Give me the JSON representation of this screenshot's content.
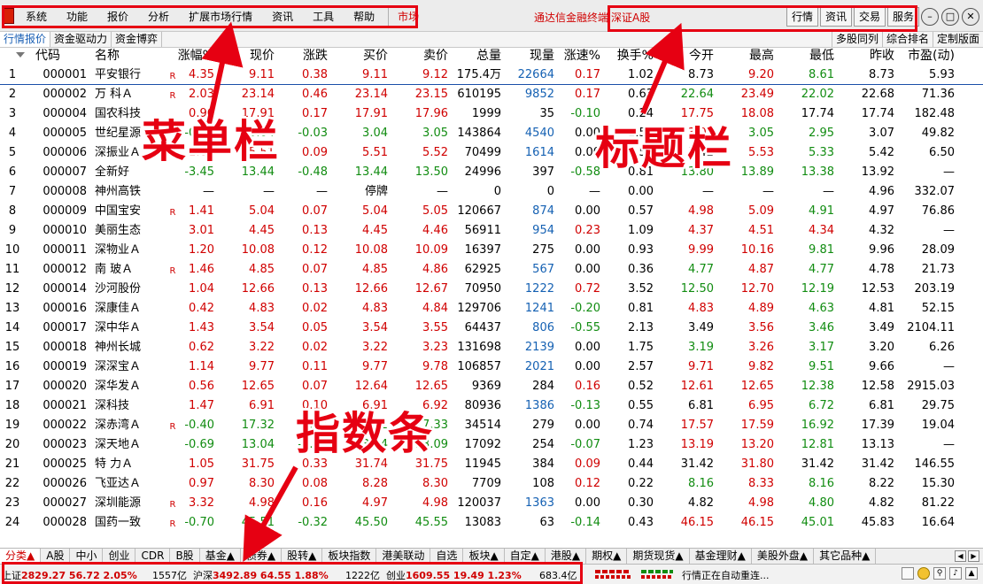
{
  "menubar": {
    "items": [
      "系统",
      "功能",
      "报价",
      "分析",
      "扩展市场行情",
      "资讯",
      "工具",
      "帮助"
    ],
    "market": "市场",
    "brand": "通达信金融终端",
    "market_name": "深证A股",
    "right_buttons": [
      "行情",
      "资讯",
      "交易",
      "服务"
    ]
  },
  "subtabs": {
    "left": [
      "行情报价",
      "资金驱动力",
      "资金博弈"
    ],
    "right": [
      "多股同列",
      "综合排名",
      "定制版面"
    ]
  },
  "table": {
    "headers": [
      "代码",
      "名称",
      "涨幅%",
      "现价",
      "涨跌",
      "买价",
      "卖价",
      "总量",
      "现量",
      "涨速%",
      "换手%",
      "今开",
      "最高",
      "最低",
      "昨收",
      "市盈(动)"
    ],
    "rows": [
      {
        "idx": "1",
        "code": "000001",
        "name": "平安银行",
        "flag": "R",
        "chg": "4.35",
        "price": "9.11",
        "updn": "0.38",
        "bid": "9.11",
        "ask": "9.12",
        "vol": "175.4万",
        "cur": "22664",
        "spd": "0.17",
        "turn": "1.02",
        "open": "8.73",
        "high": "9.20",
        "low": "8.61",
        "prev": "8.73",
        "pe": "5.93"
      },
      {
        "idx": "2",
        "code": "000002",
        "name": "万 科Ａ",
        "flag": "R",
        "chg": "2.03",
        "price": "23.14",
        "updn": "0.46",
        "bid": "23.14",
        "ask": "23.15",
        "vol": "610195",
        "cur": "9852",
        "spd": "0.17",
        "turn": "0.63",
        "open": "22.64",
        "high": "23.49",
        "low": "22.02",
        "prev": "22.68",
        "pe": "71.36"
      },
      {
        "idx": "3",
        "code": "000004",
        "name": "国农科技",
        "flag": "",
        "chg": "0.96",
        "price": "17.91",
        "updn": "0.17",
        "bid": "17.91",
        "ask": "17.96",
        "vol": "1999",
        "cur": "35",
        "spd": "-0.10",
        "turn": "0.24",
        "open": "17.75",
        "high": "18.08",
        "low": "17.74",
        "prev": "17.74",
        "pe": "182.48"
      },
      {
        "idx": "4",
        "code": "000005",
        "name": "世纪星源",
        "flag": "",
        "chg": "-0.97",
        "price": "3.04",
        "updn": "-0.03",
        "bid": "3.04",
        "ask": "3.05",
        "vol": "143864",
        "cur": "4540",
        "spd": "0.00",
        "turn": "1.57",
        "open": "3.08",
        "high": "3.05",
        "low": "2.95",
        "prev": "3.07",
        "pe": "49.82"
      },
      {
        "idx": "5",
        "code": "000006",
        "name": "深振业Ａ",
        "flag": "",
        "chg": "1.66",
        "price": "5.51",
        "updn": "0.09",
        "bid": "5.51",
        "ask": "5.52",
        "vol": "70499",
        "cur": "1614",
        "spd": "0.00",
        "turn": "0.52",
        "open": "5.42",
        "high": "5.53",
        "low": "5.33",
        "prev": "5.42",
        "pe": "6.50"
      },
      {
        "idx": "6",
        "code": "000007",
        "name": "全新好",
        "flag": "",
        "chg": "-3.45",
        "price": "13.44",
        "updn": "-0.48",
        "bid": "13.44",
        "ask": "13.50",
        "vol": "24996",
        "cur": "397",
        "spd": "-0.58",
        "turn": "0.81",
        "open": "13.80",
        "high": "13.89",
        "low": "13.38",
        "prev": "13.92",
        "pe": "—"
      },
      {
        "idx": "7",
        "code": "000008",
        "name": "神州高铁",
        "flag": "",
        "chg": "—",
        "price": "—",
        "updn": "—",
        "bid": "停牌",
        "ask": "—",
        "vol": "0",
        "cur": "0",
        "spd": "—",
        "turn": "0.00",
        "open": "—",
        "high": "—",
        "low": "—",
        "prev": "4.96",
        "pe": "332.07"
      },
      {
        "idx": "8",
        "code": "000009",
        "name": "中国宝安",
        "flag": "R",
        "chg": "1.41",
        "price": "5.04",
        "updn": "0.07",
        "bid": "5.04",
        "ask": "5.05",
        "vol": "120667",
        "cur": "874",
        "spd": "0.00",
        "turn": "0.57",
        "open": "4.98",
        "high": "5.09",
        "low": "4.91",
        "prev": "4.97",
        "pe": "76.86"
      },
      {
        "idx": "9",
        "code": "000010",
        "name": "美丽生态",
        "flag": "",
        "chg": "3.01",
        "price": "4.45",
        "updn": "0.13",
        "bid": "4.45",
        "ask": "4.46",
        "vol": "56911",
        "cur": "954",
        "spd": "0.23",
        "turn": "1.09",
        "open": "4.37",
        "high": "4.51",
        "low": "4.34",
        "prev": "4.32",
        "pe": "—"
      },
      {
        "idx": "10",
        "code": "000011",
        "name": "深物业Ａ",
        "flag": "",
        "chg": "1.20",
        "price": "10.08",
        "updn": "0.12",
        "bid": "10.08",
        "ask": "10.09",
        "vol": "16397",
        "cur": "275",
        "spd": "0.00",
        "turn": "0.93",
        "open": "9.99",
        "high": "10.16",
        "low": "9.81",
        "prev": "9.96",
        "pe": "28.09"
      },
      {
        "idx": "11",
        "code": "000012",
        "name": "南 玻Ａ",
        "flag": "R",
        "chg": "1.46",
        "price": "4.85",
        "updn": "0.07",
        "bid": "4.85",
        "ask": "4.86",
        "vol": "62925",
        "cur": "567",
        "spd": "0.00",
        "turn": "0.36",
        "open": "4.77",
        "high": "4.87",
        "low": "4.77",
        "prev": "4.78",
        "pe": "21.73"
      },
      {
        "idx": "12",
        "code": "000014",
        "name": "沙河股份",
        "flag": "",
        "chg": "1.04",
        "price": "12.66",
        "updn": "0.13",
        "bid": "12.66",
        "ask": "12.67",
        "vol": "70950",
        "cur": "1222",
        "spd": "0.72",
        "turn": "3.52",
        "open": "12.50",
        "high": "12.70",
        "low": "12.19",
        "prev": "12.53",
        "pe": "203.19"
      },
      {
        "idx": "13",
        "code": "000016",
        "name": "深康佳Ａ",
        "flag": "",
        "chg": "0.42",
        "price": "4.83",
        "updn": "0.02",
        "bid": "4.83",
        "ask": "4.84",
        "vol": "129706",
        "cur": "1241",
        "spd": "-0.20",
        "turn": "0.81",
        "open": "4.83",
        "high": "4.89",
        "low": "4.63",
        "prev": "4.81",
        "pe": "52.15"
      },
      {
        "idx": "14",
        "code": "000017",
        "name": "深中华Ａ",
        "flag": "",
        "chg": "1.43",
        "price": "3.54",
        "updn": "0.05",
        "bid": "3.54",
        "ask": "3.55",
        "vol": "64437",
        "cur": "806",
        "spd": "-0.55",
        "turn": "2.13",
        "open": "3.49",
        "high": "3.56",
        "low": "3.46",
        "prev": "3.49",
        "pe": "2104.11"
      },
      {
        "idx": "15",
        "code": "000018",
        "name": "神州长城",
        "flag": "",
        "chg": "0.62",
        "price": "3.22",
        "updn": "0.02",
        "bid": "3.22",
        "ask": "3.23",
        "vol": "131698",
        "cur": "2139",
        "spd": "0.00",
        "turn": "1.75",
        "open": "3.19",
        "high": "3.26",
        "low": "3.17",
        "prev": "3.20",
        "pe": "6.26"
      },
      {
        "idx": "16",
        "code": "000019",
        "name": "深深宝Ａ",
        "flag": "",
        "chg": "1.14",
        "price": "9.77",
        "updn": "0.11",
        "bid": "9.77",
        "ask": "9.78",
        "vol": "106857",
        "cur": "2021",
        "spd": "0.00",
        "turn": "2.57",
        "open": "9.71",
        "high": "9.82",
        "low": "9.51",
        "prev": "9.66",
        "pe": "—"
      },
      {
        "idx": "17",
        "code": "000020",
        "name": "深华发Ａ",
        "flag": "",
        "chg": "0.56",
        "price": "12.65",
        "updn": "0.07",
        "bid": "12.64",
        "ask": "12.65",
        "vol": "9369",
        "cur": "284",
        "spd": "0.16",
        "turn": "0.52",
        "open": "12.61",
        "high": "12.65",
        "low": "12.38",
        "prev": "12.58",
        "pe": "2915.03"
      },
      {
        "idx": "18",
        "code": "000021",
        "name": "深科技",
        "flag": "",
        "chg": "1.47",
        "price": "6.91",
        "updn": "0.10",
        "bid": "6.91",
        "ask": "6.92",
        "vol": "80936",
        "cur": "1386",
        "spd": "-0.13",
        "turn": "0.55",
        "open": "6.81",
        "high": "6.95",
        "low": "6.72",
        "prev": "6.81",
        "pe": "29.75"
      },
      {
        "idx": "19",
        "code": "000022",
        "name": "深赤湾Ａ",
        "flag": "R",
        "chg": "-0.40",
        "price": "17.32",
        "updn": "-0.07",
        "bid": "17.32",
        "ask": "17.33",
        "vol": "34514",
        "cur": "279",
        "spd": "0.00",
        "turn": "0.74",
        "open": "17.57",
        "high": "17.59",
        "low": "16.92",
        "prev": "17.39",
        "pe": "19.04"
      },
      {
        "idx": "20",
        "code": "000023",
        "name": "深天地Ａ",
        "flag": "",
        "chg": "-0.69",
        "price": "13.04",
        "updn": "-0.09",
        "bid": "13.04",
        "ask": "13.09",
        "vol": "17092",
        "cur": "254",
        "spd": "-0.07",
        "turn": "1.23",
        "open": "13.19",
        "high": "13.20",
        "low": "12.81",
        "prev": "13.13",
        "pe": "—"
      },
      {
        "idx": "21",
        "code": "000025",
        "name": "特 力Ａ",
        "flag": "",
        "chg": "1.05",
        "price": "31.75",
        "updn": "0.33",
        "bid": "31.74",
        "ask": "31.75",
        "vol": "11945",
        "cur": "384",
        "spd": "0.09",
        "turn": "0.44",
        "open": "31.42",
        "high": "31.80",
        "low": "31.42",
        "prev": "31.42",
        "pe": "146.55"
      },
      {
        "idx": "22",
        "code": "000026",
        "name": "飞亚达Ａ",
        "flag": "",
        "chg": "0.97",
        "price": "8.30",
        "updn": "0.08",
        "bid": "8.28",
        "ask": "8.30",
        "vol": "7709",
        "cur": "108",
        "spd": "0.12",
        "turn": "0.22",
        "open": "8.16",
        "high": "8.33",
        "low": "8.16",
        "prev": "8.22",
        "pe": "15.30"
      },
      {
        "idx": "23",
        "code": "000027",
        "name": "深圳能源",
        "flag": "R",
        "chg": "3.32",
        "price": "4.98",
        "updn": "0.16",
        "bid": "4.97",
        "ask": "4.98",
        "vol": "120037",
        "cur": "1363",
        "spd": "0.00",
        "turn": "0.30",
        "open": "4.82",
        "high": "4.98",
        "low": "4.80",
        "prev": "4.82",
        "pe": "81.22"
      },
      {
        "idx": "24",
        "code": "000028",
        "name": "国药一致",
        "flag": "R",
        "chg": "-0.70",
        "price": "45.51",
        "updn": "-0.32",
        "bid": "45.50",
        "ask": "45.55",
        "vol": "13083",
        "cur": "63",
        "spd": "-0.14",
        "turn": "0.43",
        "open": "46.15",
        "high": "46.15",
        "low": "45.01",
        "prev": "45.83",
        "pe": "16.64"
      }
    ]
  },
  "annotations": {
    "menu": "菜单栏",
    "title": "标题栏",
    "index": "指数条"
  },
  "cattabs": [
    "分类▲",
    "A股",
    "中小",
    "创业",
    "CDR",
    "B股",
    "基金▲",
    "债券▲",
    "股转▲",
    "板块指数",
    "港美联动",
    "自选",
    "板块▲",
    "自定▲",
    "港股▲",
    "期权▲",
    "期货现货▲",
    "基金理财▲",
    "美股外盘▲",
    "其它品种▲"
  ],
  "statusbar": {
    "sh_name": "上证",
    "sh_val": "2829.27  56.72  2.05%",
    "sh_amt": "1557亿",
    "sz_name": "沪深",
    "sz_val": "3492.89  64.55  1.88%",
    "sz_amt": "1222亿",
    "cy_name": "创业",
    "cy_val": "1609.55  19.49  1.23%",
    "cy_amt": "683.4亿",
    "message": "行情正在自动重连..."
  },
  "colors": {
    "up": "#d00000",
    "down": "#118c11",
    "blue": "#1561b3",
    "annotation": "#e60012"
  }
}
